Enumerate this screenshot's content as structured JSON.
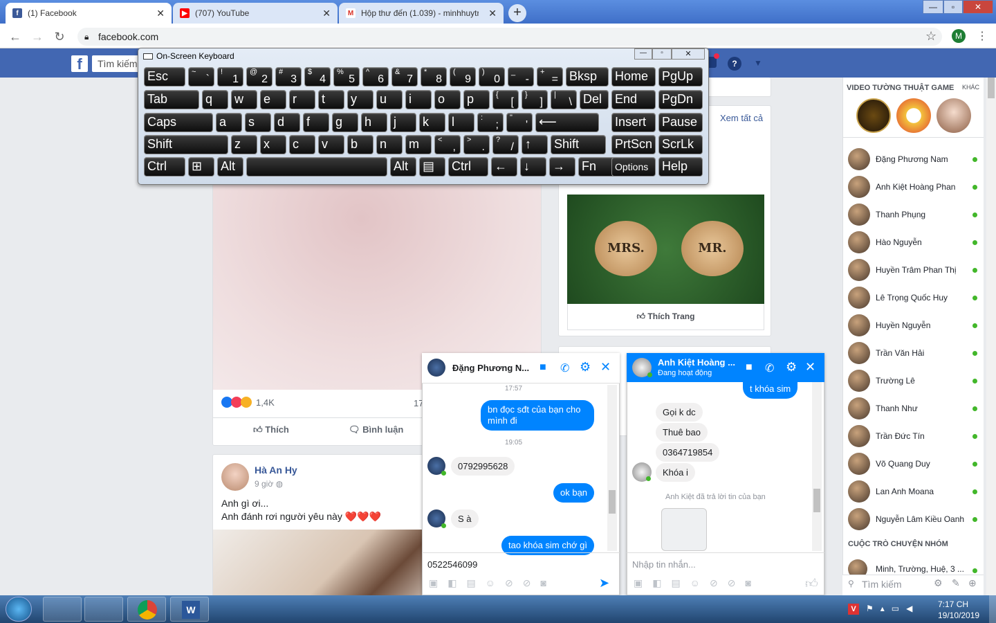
{
  "browser": {
    "tabs": [
      {
        "label": "(1) Facebook",
        "icon": "facebook-icon"
      },
      {
        "label": "(707) YouTube",
        "icon": "youtube-icon"
      },
      {
        "label": "Hộp thư đến (1.039) - minhhuytr",
        "icon": "gmail-icon"
      }
    ],
    "url": "facebook.com",
    "profile_initial": "M"
  },
  "fb": {
    "logo": "f",
    "search_placeholder": "Tìm kiếm"
  },
  "osk": {
    "title": "On-Screen Keyboard",
    "rows": [
      [
        [
          "Esc",
          ""
        ],
        [
          "`",
          "~"
        ],
        [
          "1",
          "!"
        ],
        [
          "2",
          "@"
        ],
        [
          "3",
          "#"
        ],
        [
          "4",
          "$"
        ],
        [
          "5",
          "%"
        ],
        [
          "6",
          "^"
        ],
        [
          "7",
          "&"
        ],
        [
          "8",
          "*"
        ],
        [
          "9",
          "("
        ],
        [
          "0",
          ")"
        ],
        [
          "-",
          "_"
        ],
        [
          "=",
          "+"
        ],
        [
          "Bksp",
          ""
        ],
        [
          "Home",
          ""
        ],
        [
          "PgUp",
          ""
        ]
      ],
      [
        [
          "Tab",
          ""
        ],
        [
          "q",
          ""
        ],
        [
          "w",
          ""
        ],
        [
          "e",
          ""
        ],
        [
          "r",
          ""
        ],
        [
          "t",
          ""
        ],
        [
          "y",
          ""
        ],
        [
          "u",
          ""
        ],
        [
          "i",
          ""
        ],
        [
          "o",
          ""
        ],
        [
          "p",
          ""
        ],
        [
          "[",
          "{"
        ],
        [
          "]",
          "}"
        ],
        [
          "\\",
          "|"
        ],
        [
          "Del",
          ""
        ],
        [
          "End",
          ""
        ],
        [
          "PgDn",
          ""
        ]
      ],
      [
        [
          "Caps",
          ""
        ],
        [
          "a",
          ""
        ],
        [
          "s",
          ""
        ],
        [
          "d",
          ""
        ],
        [
          "f",
          ""
        ],
        [
          "g",
          ""
        ],
        [
          "h",
          ""
        ],
        [
          "j",
          ""
        ],
        [
          "k",
          ""
        ],
        [
          "l",
          ""
        ],
        [
          ";",
          ":"
        ],
        [
          "'",
          "\""
        ],
        [
          "⟵",
          ""
        ],
        [
          "Insert",
          ""
        ],
        [
          "Pause",
          ""
        ]
      ],
      [
        [
          "Shift",
          ""
        ],
        [
          "z",
          ""
        ],
        [
          "x",
          ""
        ],
        [
          "c",
          ""
        ],
        [
          "v",
          ""
        ],
        [
          "b",
          ""
        ],
        [
          "n",
          ""
        ],
        [
          "m",
          ""
        ],
        [
          ",",
          "<"
        ],
        [
          ".",
          ">"
        ],
        [
          "/",
          "?"
        ],
        [
          "↑",
          ""
        ],
        [
          "Shift",
          ""
        ],
        [
          "PrtScn",
          ""
        ],
        [
          "ScrLk",
          ""
        ]
      ],
      [
        [
          "Ctrl",
          ""
        ],
        [
          "⊞",
          ""
        ],
        [
          "Alt",
          ""
        ],
        [
          "",
          ""
        ],
        [
          "Alt",
          ""
        ],
        [
          "▤",
          ""
        ],
        [
          "Ctrl",
          ""
        ],
        [
          "←",
          ""
        ],
        [
          "↓",
          ""
        ],
        [
          "→",
          ""
        ],
        [
          "Fn",
          ""
        ],
        [
          "Options",
          ""
        ],
        [
          "Help",
          ""
        ]
      ]
    ]
  },
  "feed": {
    "post1": {
      "reactions_count": "1,4K",
      "comments_partial": "17",
      "like_label": "Thích",
      "comment_label": "Bình luận"
    },
    "post2": {
      "author": "Hà An Hy",
      "time": "9 giờ",
      "line1": "Anh gì ơi...",
      "line2": "Anh đánh rơi người yêu này ❤️❤️❤️"
    }
  },
  "right_col": {
    "see_all": "Xem tất cả",
    "page_like": "Thích Trang",
    "image_text_left": "MRS.",
    "image_text_right": "MR."
  },
  "chat1": {
    "name": "Đặng Phương N...",
    "time1": "17:57",
    "msg_me1": "bn đọc sđt  của bạn cho mình đi",
    "time2": "19:05",
    "msg_them1": "0792995628",
    "msg_me2": "ok bạn",
    "msg_them2": "S à",
    "msg_me3": "tao khóa sim chớ gì",
    "input_value": "0522546099"
  },
  "chat2": {
    "name": "Anh Kiệt Hoàng ...",
    "status": "Đang hoạt động",
    "msg_me1": "t khóa sim",
    "msg_them1": "Gọi k dc",
    "msg_them2": "Thuê bao",
    "msg_them3": "0364719854",
    "msg_them4": "Khóa i",
    "reply_note": "Anh Kiệt đã trả lời tin của bạn",
    "input_placeholder": "Nhập tin nhắn..."
  },
  "sidebar": {
    "video_header": "VIDEO TƯỜNG THUẬT GAME",
    "video_more": "KHÁC",
    "contacts": [
      "Đặng Phương Nam",
      "Anh Kiệt Hoàng Phan",
      "Thanh Phụng",
      "Hào Nguyễn",
      "Huyền Trâm Phan Thị",
      "Lê Trọng Quốc Huy",
      "Huyền Nguyễn",
      "Trần Văn Hải",
      "Trường Lê",
      "Thanh Như",
      "Trần Đức Tín",
      "Võ Quang Duy",
      "Lan Anh Moana",
      "Nguyễn Lâm Kiều Oanh"
    ],
    "group_header": "CUỘC TRÒ CHUYỆN NHÓM",
    "group_item": "Minh, Trường, Huệ, 3 ...",
    "search_placeholder": "Tìm kiếm"
  },
  "taskbar": {
    "time": "7:17 CH",
    "date": "19/10/2019"
  },
  "colors": {
    "fb_blue": "#4267b2",
    "messenger_blue": "#0084ff",
    "online_green": "#42b72a"
  }
}
